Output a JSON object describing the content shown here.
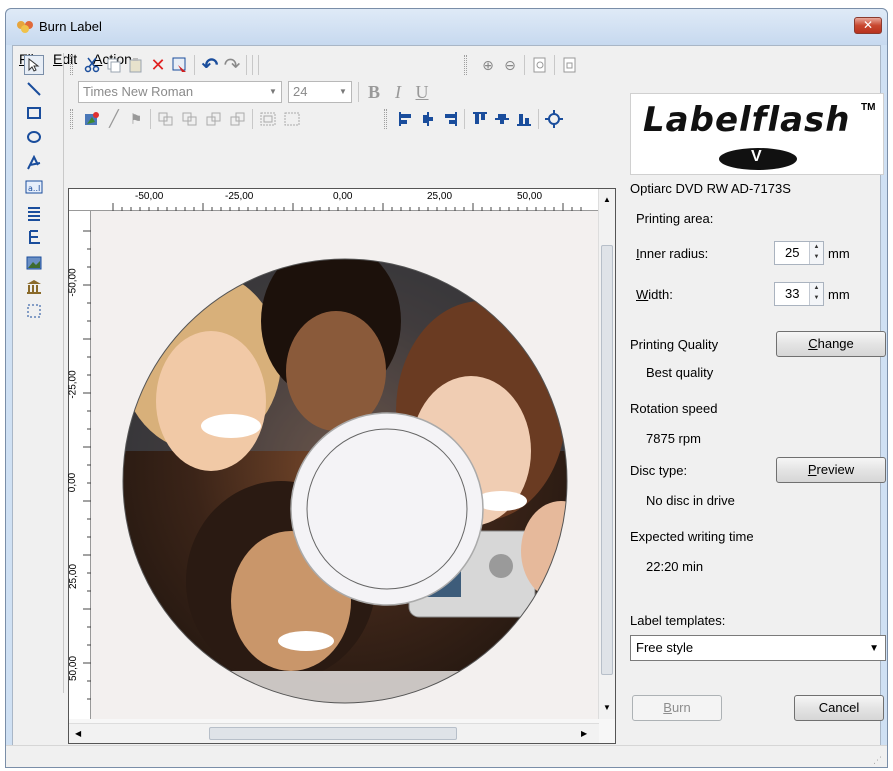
{
  "window": {
    "title": "Burn Label",
    "close_label": "✕"
  },
  "menu": {
    "items": [
      "File",
      "Edit",
      "Action"
    ]
  },
  "toolbar": {
    "font_name": "Times New Roman",
    "font_size": "24",
    "bold": "B",
    "italic": "I",
    "underline": "U"
  },
  "rulers": {
    "top_ticks": [
      "-50,00",
      "-25,00",
      "0,00",
      "25,00",
      "50,00"
    ],
    "left_ticks": [
      "-50,00",
      "-25,00",
      "0,00",
      "25,00",
      "50,00"
    ]
  },
  "right_panel": {
    "logo_text": "Labelflash",
    "logo_tm": "TM",
    "drive_name": "Optiarc DVD RW AD-7173S",
    "printing_area_label": "Printing area:",
    "inner_radius_label": "Inner radius:",
    "inner_radius_value": "25",
    "inner_radius_unit": "mm",
    "width_label": "Width:",
    "width_value": "33",
    "width_unit": "mm",
    "printing_quality_label": "Printing Quality",
    "printing_quality_value": "Best quality",
    "change_button": "Change",
    "rotation_speed_label": "Rotation speed",
    "rotation_speed_value": "7875 rpm",
    "disc_type_label": "Disc type:",
    "disc_type_value": "No disc in drive",
    "preview_button": "Preview",
    "expected_time_label": "Expected writing time",
    "expected_time_value": "22:20 min",
    "templates_label": "Label templates:",
    "templates_value": "Free style",
    "burn_button": "Burn",
    "cancel_button": "Cancel"
  },
  "colors": {
    "title_bar": "#cfe0f3",
    "close_button": "#c8472f",
    "accent": "#1a4d9c"
  }
}
